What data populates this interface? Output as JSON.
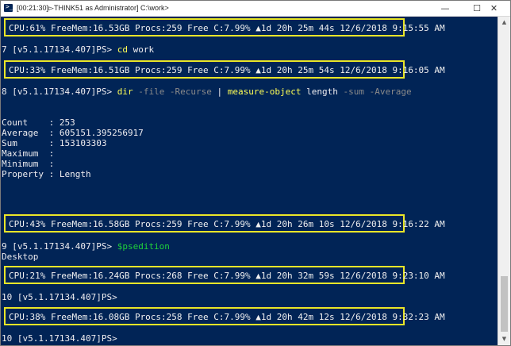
{
  "window": {
    "title": "[00:21:30]▻THINK51 as Administrator]  C:\\work>",
    "icon_glyph": ">_",
    "buttons": {
      "minimize": "—",
      "maximize": "☐",
      "close": "✕"
    }
  },
  "colors": {
    "console_bg": "#012456",
    "status_border": "#e9e628",
    "command": "#ffff55",
    "parameter": "#8a8a8a",
    "variable": "#1fd13a",
    "text": "#eeedf0"
  },
  "console": {
    "status_1": "CPU:61% FreeMem:16.53GB Procs:259 Free C:7.99% ▲1d 20h 25m 44s 12/6/2018 9:15:55 AM",
    "prompt_1": "7 [v5.1.17134.407]PS> ",
    "cmd_1": "cd",
    "arg_1": " work",
    "status_2": "CPU:33% FreeMem:16.51GB Procs:259 Free C:7.99% ▲1d 20h 25m 54s 12/6/2018 9:16:05 AM",
    "prompt_2": "8 [v5.1.17134.407]PS> ",
    "cmd_2a": "dir",
    "param_2a": " -file -Recurse",
    "pipe_2": " | ",
    "cmd_2b": "measure-object",
    "arg_2b": " length",
    "param_2b": " -sum -Average",
    "output_rows": [
      "Count    : 253",
      "Average  : 605151.395256917",
      "Sum      : 153103303",
      "Maximum  :",
      "Minimum  :",
      "Property : Length"
    ],
    "status_3": "CPU:43% FreeMem:16.58GB Procs:259 Free C:7.99% ▲1d 20h 26m 10s 12/6/2018 9:16:22 AM",
    "prompt_3": "9 [v5.1.17134.407]PS> ",
    "var_3": "$psedition",
    "output_3": "Desktop",
    "status_4": "CPU:21% FreeMem:16.24GB Procs:268 Free C:7.99% ▲1d 20h 32m 59s 12/6/2018 9:23:10 AM",
    "prompt_4": "10 [v5.1.17134.407]PS>",
    "status_5": "CPU:38% FreeMem:16.08GB Procs:258 Free C:7.99% ▲1d 20h 42m 12s 12/6/2018 9:32:23 AM",
    "prompt_5": "10 [v5.1.17134.407]PS>"
  },
  "scrollbar": {
    "up_icon": "chevron-up-icon",
    "down_icon": "chevron-down-icon"
  }
}
